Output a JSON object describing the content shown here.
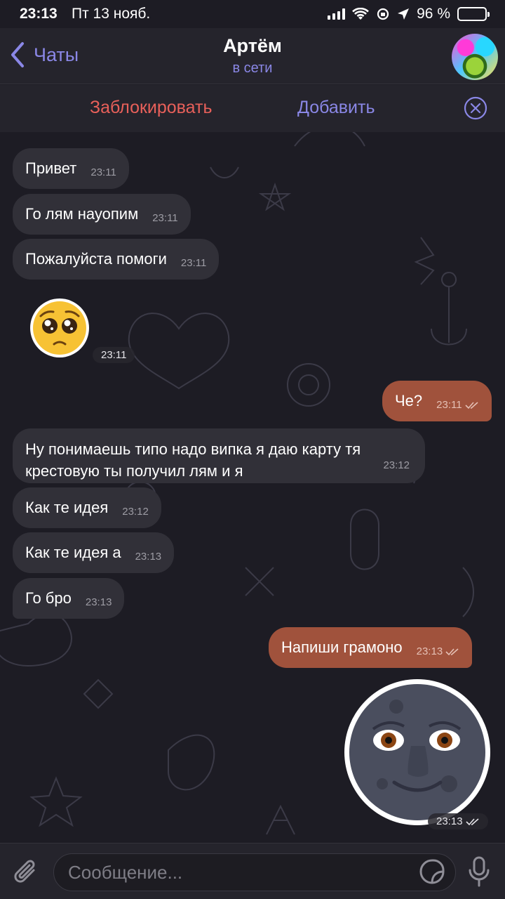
{
  "status_bar": {
    "time": "23:13",
    "date": "Пт 13 нояб.",
    "battery": "96 %",
    "battery_level": 0.96
  },
  "header": {
    "back_label": "Чаты",
    "contact_name": "Артём",
    "contact_status": "в сети",
    "accent_color": "#8a87e6"
  },
  "actions": {
    "block_label": "Заблокировать",
    "add_label": "Добавить",
    "block_color": "#e8605a"
  },
  "messages": [
    {
      "dir": "in",
      "text": "Привет",
      "time": "23:11"
    },
    {
      "dir": "in",
      "text": "Го лям науопим",
      "time": "23:11"
    },
    {
      "dir": "in",
      "text": "Пожалуйста помоги",
      "time": "23:11"
    },
    {
      "dir": "in",
      "sticker": "pleading-face-emoji",
      "time": "23:11"
    },
    {
      "dir": "out",
      "text": "Че?",
      "time": "23:11",
      "read": true
    },
    {
      "dir": "in",
      "text_line1": "Ну понимаешь типо надо випка я даю карту тя",
      "text_line2": "крестовую ты получил лям и я",
      "time": "23:12"
    },
    {
      "dir": "in",
      "text": "Как те идея",
      "time": "23:12"
    },
    {
      "dir": "in",
      "text": "Как те идея а",
      "time": "23:13"
    },
    {
      "dir": "in",
      "text": "Го бро",
      "time": "23:13"
    },
    {
      "dir": "out",
      "text": "Напиши грамоно",
      "time": "23:13",
      "read": true
    },
    {
      "dir": "out",
      "sticker": "new-moon-face-emoji",
      "time": "23:13",
      "read": true
    }
  ],
  "input": {
    "placeholder": "Сообщение..."
  },
  "colors": {
    "incoming_bubble": "#313038",
    "outgoing_bubble": "#a0523c",
    "background": "#1d1c24"
  }
}
